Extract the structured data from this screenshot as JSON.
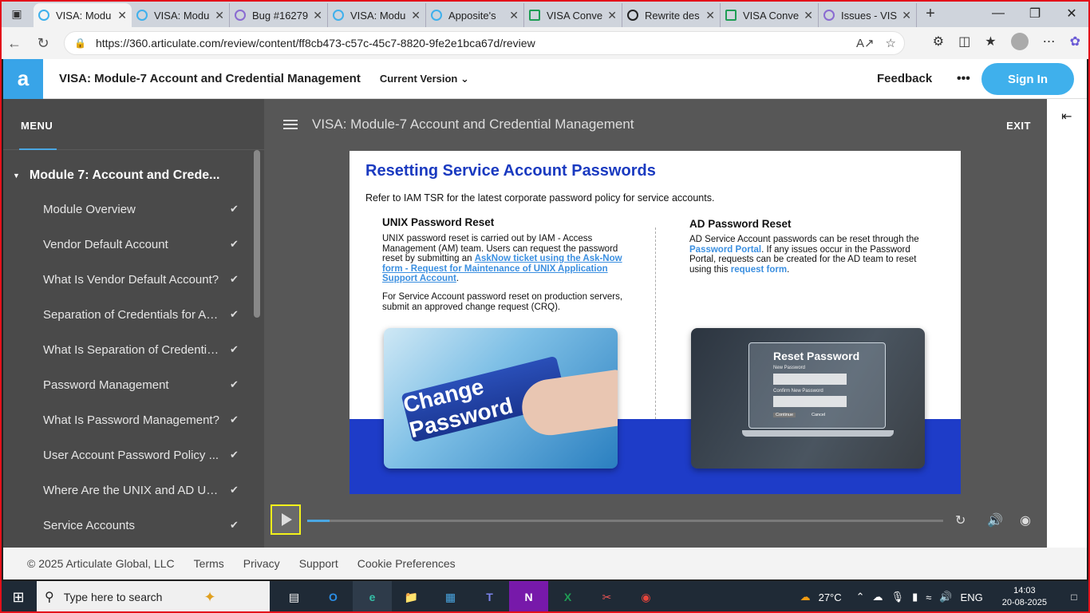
{
  "browser": {
    "tabs": [
      {
        "label": "VISA: Modu",
        "active": true,
        "icon": "articulate-icon"
      },
      {
        "label": "VISA: Modu",
        "active": false,
        "icon": "articulate-icon"
      },
      {
        "label": "Bug #16279",
        "active": false,
        "icon": "bug-icon"
      },
      {
        "label": "VISA: Modu",
        "active": false,
        "icon": "articulate-icon"
      },
      {
        "label": "Apposite's",
        "active": false,
        "icon": "articulate-icon"
      },
      {
        "label": "VISA Conve",
        "active": false,
        "icon": "excel-icon"
      },
      {
        "label": "Rewrite des",
        "active": false,
        "icon": "chatgpt-icon"
      },
      {
        "label": "VISA Conve",
        "active": false,
        "icon": "excel-icon"
      },
      {
        "label": "Issues - VIS",
        "active": false,
        "icon": "bug-icon"
      }
    ],
    "url": "https://360.articulate.com/review/content/ff8cb473-c57c-45c7-8820-9fe2e1bca67d/review"
  },
  "header": {
    "title": "VISA: Module-7 Account and Credential Management",
    "version": "Current Version",
    "feedback": "Feedback",
    "more": "•••",
    "signin": "Sign In"
  },
  "sidebar": {
    "menu_label": "MENU",
    "module": "Module 7: Account and Crede...",
    "lessons": [
      "Module Overview",
      "Vendor Default Account",
      "What Is Vendor Default Account?",
      "Separation of Credentials for Accounts",
      "What Is Separation of Credentials?",
      "Password Management",
      "What Is Password Management?",
      "User Account Password Policy ...",
      "Where Are the UNIX and AD Users?",
      "Service Accounts"
    ]
  },
  "player": {
    "title": "VISA: Module-7 Account and Credential Management",
    "exit": "EXIT",
    "progress": 0.035
  },
  "slide": {
    "title": "Resetting Service Account Passwords",
    "subtitle": "Refer to IAM TSR for the latest corporate password policy for service accounts.",
    "left": {
      "heading": "UNIX Password Reset",
      "p1_a": "UNIX password reset is carried out by IAM - Access Management (AM) team. Users can request the password reset by submitting an ",
      "p1_link": "AskNow ticket using the Ask-Now form - Request for Maintenance of UNIX Application Support Account",
      "p1_b": ".",
      "p2": "For Service Account password reset on production servers, submit an approved change request (CRQ).",
      "image_text": "Change Password"
    },
    "right": {
      "heading": "AD Password Reset",
      "p1_a": "AD Service Account passwords can be reset through the ",
      "p1_link1": "Password Portal",
      "p1_b": ". If any issues occur in the Password Portal, requests can be created for the AD team to reset using this ",
      "p1_link2": "request form",
      "p1_c": ".",
      "img_title": "Reset Password",
      "img_new": "New Password",
      "img_confirm": "Confirm New Password",
      "img_continue": "Continue",
      "img_cancel": "Cancel"
    }
  },
  "footer": {
    "copyright": "© 2025 Articulate Global, LLC",
    "terms": "Terms",
    "privacy": "Privacy",
    "support": "Support",
    "cookies": "Cookie Preferences"
  },
  "taskbar": {
    "search_placeholder": "Type here to search",
    "temp": "27°C",
    "lang": "ENG",
    "time": "14:03",
    "date": "20-08-2025"
  },
  "colors": {
    "accent": "#3fb0ec",
    "slide_blue": "#1e3cc8",
    "play_highlight": "#f3f21a",
    "frame": "#e3101a"
  }
}
